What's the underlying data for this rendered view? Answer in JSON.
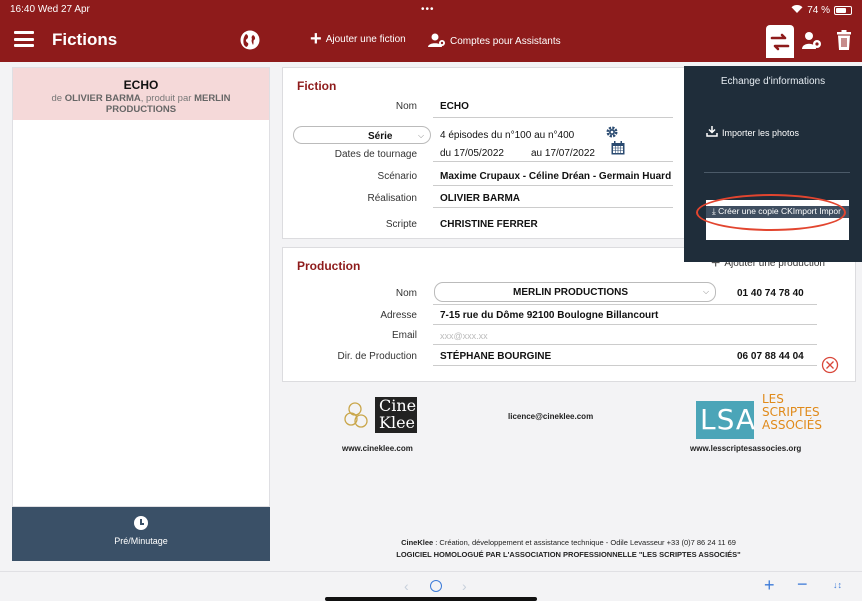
{
  "status": {
    "time": "16:40",
    "date": "Wed 27 Apr",
    "dots": "•••",
    "battery": "74 %",
    "battery_level": 0.74
  },
  "nav": {
    "title": "Fictions",
    "add_fiction": "Ajouter une fiction",
    "assistants": "Comptes pour Assistants"
  },
  "sidebar": {
    "item": {
      "title": "ECHO",
      "sub_prefix": "de",
      "director": "OLIVIER BARMA",
      "sub_mid": ", produit par",
      "producer": "MERLIN PRODUCTIONS"
    },
    "pre_button": "Pré/Minutage"
  },
  "fiction": {
    "heading": "Fiction",
    "nom_label": "Nom",
    "nom_value": "ECHO",
    "type_value": "Série",
    "episodes": "4 épisodes du n°100 au n°400",
    "dates_label": "Dates de tournage",
    "date_from": "du 17/05/2022",
    "date_to": "au 17/07/2022",
    "scenario_label": "Scénario",
    "scenario_value": "Maxime Crupaux - Céline Dréan - Germain Huard",
    "realisation_label": "Réalisation",
    "realisation_value": "OLIVIER BARMA",
    "scripte_label": "Scripte",
    "scripte_value": "CHRISTINE FERRER"
  },
  "production": {
    "heading": "Production",
    "add_label": "Ajouter une production",
    "nom_label": "Nom",
    "nom_value": "MERLIN PRODUCTIONS",
    "phone": "01 40 74 78 40",
    "adresse_label": "Adresse",
    "adresse_value": "7-15 rue du Dôme 92100 Boulogne Billancourt",
    "email_label": "Email",
    "email_placeholder": "xxx@xxx.xx",
    "dir_label": "Dir. de Production",
    "dir_value": "STÉPHANE BOURGINE",
    "dir_phone": "06 07 88 44 04"
  },
  "popover": {
    "title": "Echange d'informations",
    "import_photos": "Importer les photos",
    "create_copy": "Créer une copie CKImport Impor"
  },
  "logos": {
    "cineklee_line1": "Cine",
    "cineklee_line2": "Klee",
    "cineklee_url": "www.cineklee.com",
    "email": "licence@cineklee.com",
    "lsa_mark": "LSA",
    "lsa_line1": "LES",
    "lsa_line2": "SCRIPTES",
    "lsa_line3": "ASSOCIÉS",
    "lsa_url": "www.lesscriptesassocies.org"
  },
  "footer": {
    "brand": "CineKlee",
    "credit": " : Création, développement et assistance technique - Odile Levasseur +33 (0)7 86 24 11 69",
    "homologue": "LOGICIEL HOMOLOGUÉ PAR L'ASSOCIATION PROFESSIONNELLE \"LES SCRIPTES ASSOCIÉS\""
  },
  "colors": {
    "brand": "#8e1b1b",
    "accent": "#3d7bd8",
    "popover": "#1f2d3a",
    "sidebar_button": "#3a5067",
    "highlight": "#e2452f"
  }
}
